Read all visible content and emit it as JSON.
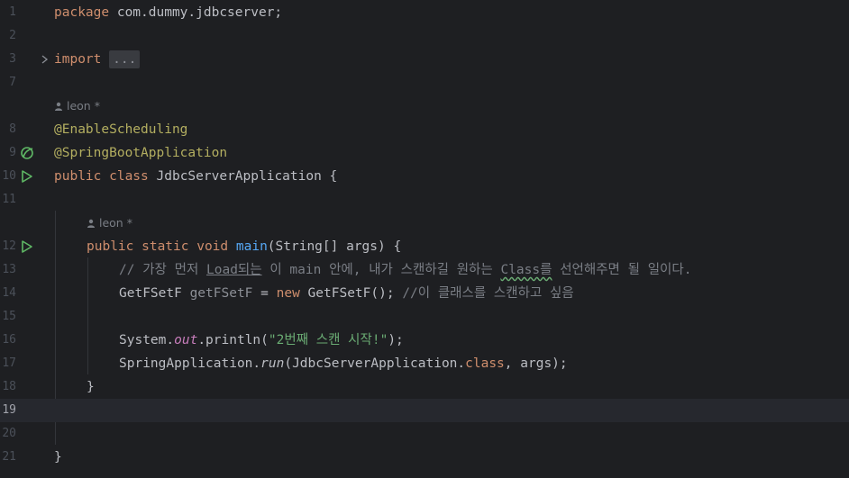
{
  "editor": {
    "lines": [
      {
        "ln": "1",
        "parts": [
          {
            "t": "package",
            "c": "kw"
          },
          {
            "t": " com.dummy.jdbcserver;"
          }
        ]
      },
      {
        "ln": "2"
      },
      {
        "ln": "3",
        "fold": true,
        "parts": [
          {
            "t": "import",
            "c": "kw"
          },
          {
            "t": " "
          },
          {
            "t": "...",
            "c": "folded"
          }
        ]
      },
      {
        "ln": "7"
      },
      {
        "hint": "leon *",
        "indent": 0
      },
      {
        "ln": "8",
        "parts": [
          {
            "t": "@EnableScheduling",
            "c": "ann"
          }
        ]
      },
      {
        "ln": "9",
        "icon": "bean-icon",
        "parts": [
          {
            "t": "@SpringBootApplication",
            "c": "ann"
          }
        ]
      },
      {
        "ln": "10",
        "icon": "run-icon",
        "parts": [
          {
            "t": "public class ",
            "c": "kw"
          },
          {
            "t": "JdbcServerApplication {"
          }
        ]
      },
      {
        "ln": "11"
      },
      {
        "hint": "leon *",
        "indent": 1
      },
      {
        "ln": "12",
        "icon": "run-icon",
        "indent": 1,
        "parts": [
          {
            "t": "public static void ",
            "c": "kw"
          },
          {
            "t": "main",
            "c": "fn"
          },
          {
            "t": "(String[] args) {"
          }
        ]
      },
      {
        "ln": "13",
        "indent": 2,
        "parts": [
          {
            "t": "// 가장 먼저 ",
            "c": "cmt"
          },
          {
            "t": "Load되는",
            "c": "cmt u"
          },
          {
            "t": " 이 main 안에, 내가 스캔하길 원하는 ",
            "c": "cmt"
          },
          {
            "t": "Class를",
            "c": "cmt wavy"
          },
          {
            "t": " 선언해주면 될 일이다.",
            "c": "cmt"
          }
        ]
      },
      {
        "ln": "14",
        "indent": 2,
        "parts": [
          {
            "t": "GetFSetF "
          },
          {
            "t": "getFSetF",
            "c": "var-unused"
          },
          {
            "t": " = "
          },
          {
            "t": "new ",
            "c": "kw"
          },
          {
            "t": "GetFSetF(); "
          },
          {
            "t": "//이 클래스를 스캔하고 싶음",
            "c": "cmt"
          }
        ]
      },
      {
        "ln": "15"
      },
      {
        "ln": "16",
        "indent": 2,
        "parts": [
          {
            "t": "System."
          },
          {
            "t": "out",
            "c": "stat"
          },
          {
            "t": ".println("
          },
          {
            "t": "\"2번째 스캔 시작!\"",
            "c": "str"
          },
          {
            "t": ");"
          }
        ]
      },
      {
        "ln": "17",
        "indent": 2,
        "parts": [
          {
            "t": "SpringApplication."
          },
          {
            "t": "run",
            "c": "ital"
          },
          {
            "t": "(JdbcServerApplication."
          },
          {
            "t": "class",
            "c": "kw"
          },
          {
            "t": ", args);"
          }
        ]
      },
      {
        "ln": "18",
        "indent": 1,
        "parts": [
          {
            "t": "}"
          }
        ]
      },
      {
        "ln": "19",
        "current": true
      },
      {
        "ln": "20"
      },
      {
        "ln": "21",
        "parts": [
          {
            "t": "}"
          }
        ]
      }
    ]
  }
}
